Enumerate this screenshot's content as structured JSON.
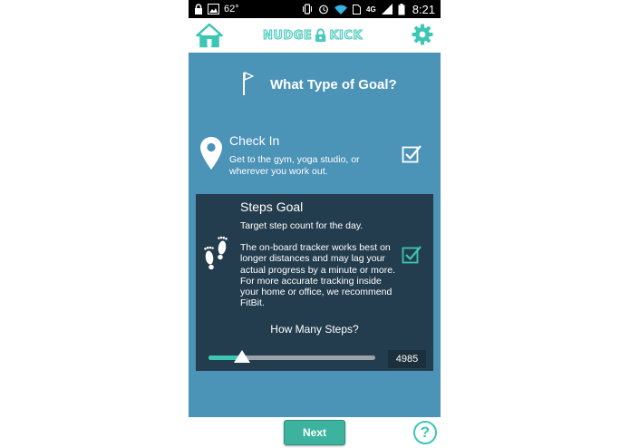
{
  "status_bar": {
    "temperature": "62°",
    "network": "4G",
    "time": "8:21"
  },
  "header": {
    "logo_left": "NUDGE",
    "logo_right": "KICK"
  },
  "page": {
    "title": "What Type of Goal?"
  },
  "goals": {
    "check_in": {
      "title": "Check In",
      "description": "Get to the gym, yoga studio, or wherever you work out.",
      "selected": true
    },
    "steps": {
      "title": "Steps Goal",
      "subtitle": "Target step count for the day.",
      "description": "The on-board tracker works best on longer distances and may lag your actual progress by a minute or more. For more accurate tracking inside your home or office, we recommend FitBit.",
      "question": "How Many Steps?",
      "value": "4985",
      "slider_fraction": 0.2,
      "selected": true
    }
  },
  "footer": {
    "next_label": "Next",
    "help_label": "?"
  },
  "colors": {
    "accent": "#3cc6b4",
    "panel": "#4b93b7",
    "dark_card": "#243d4e",
    "next_button": "#3cb39e"
  }
}
